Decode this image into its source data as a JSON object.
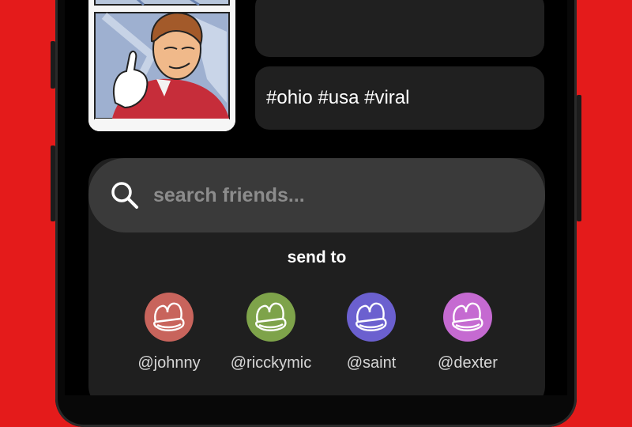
{
  "post": {
    "hashtags": "#ohio #usa #viral"
  },
  "search": {
    "placeholder": "search friends..."
  },
  "send_to": {
    "title": "send to",
    "friends": [
      {
        "handle": "@johnny",
        "color": "#c8645c"
      },
      {
        "handle": "@ricckymic",
        "color": "#7ea34a"
      },
      {
        "handle": "@saint",
        "color": "#6b60cf"
      },
      {
        "handle": "@dexter",
        "color": "#c56ad1"
      }
    ]
  },
  "colors": {
    "background": "#e41b1b",
    "screen": "#000000",
    "sheet": "#1f1f1f",
    "search_field": "#3a3a3a"
  }
}
